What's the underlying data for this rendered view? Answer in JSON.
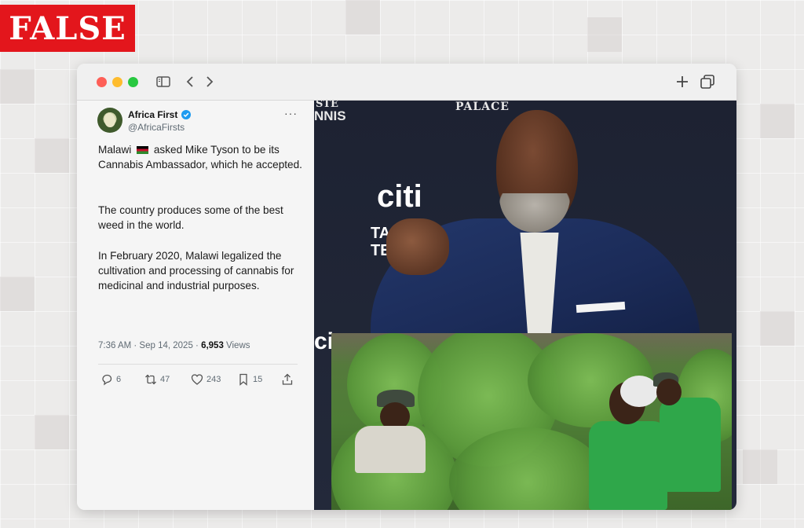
{
  "verdict": "FALSE",
  "browser": {
    "icons": [
      "sidebar-toggle-icon",
      "back-icon",
      "forward-icon",
      "new-tab-icon",
      "tabs-overview-icon"
    ]
  },
  "tweet": {
    "display_name": "Africa First",
    "handle": "@AfricaFirsts",
    "more": "···",
    "paragraphs": {
      "p1_before": "Malawi",
      "p1_after": "asked Mike Tyson to be its Cannabis Ambassador, which he accepted.",
      "p2": "The country produces some of the best weed in the world.",
      "p3": "In February 2020, Malawi legalized the cultivation and processing of cannabis for medicinal and industrial purposes."
    },
    "timestamp": "7:36 AM · Sep 14, 2025 · ",
    "views_count": "6,953",
    "views_label": " Views",
    "actions": {
      "replies": "6",
      "reposts": "47",
      "likes": "243",
      "bookmarks": "15"
    }
  },
  "photo": {
    "wall_texts": {
      "palace": "PALACE",
      "tennis_top": "STE",
      "tennis": "NNIS",
      "citi": "citi",
      "taste": "TAS",
      "tennis2": "TE",
      "citi_small": "ci"
    }
  },
  "colors": {
    "verdict_bg": "#e3161c",
    "verified": "#1d9bf0",
    "worker_shirt": "#2fa74a"
  }
}
